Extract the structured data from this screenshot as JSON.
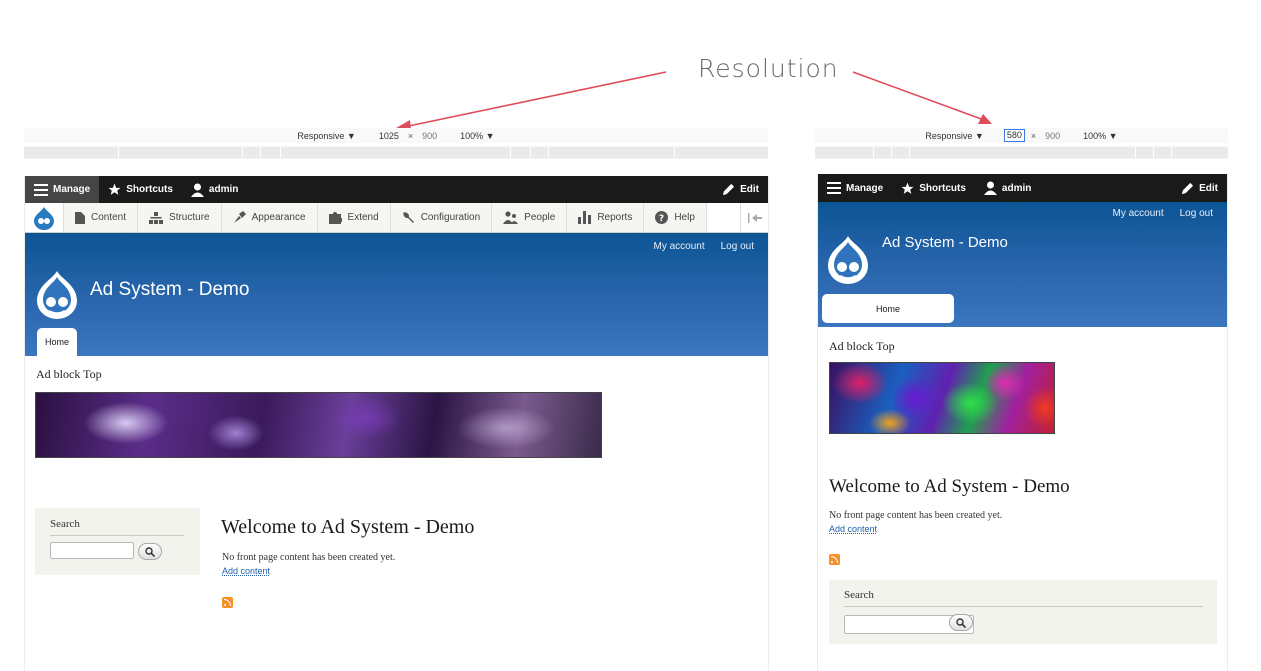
{
  "annotation": {
    "label": "Resolution"
  },
  "left_view": {
    "device": {
      "mode": "Responsive ▼",
      "width": "1025",
      "times": "×",
      "height": "900",
      "zoom": "100% ▼"
    },
    "toolbar": {
      "manage": "Manage",
      "shortcuts": "Shortcuts",
      "user": "admin",
      "edit": "Edit"
    },
    "tray": [
      "Content",
      "Structure",
      "Appearance",
      "Extend",
      "Configuration",
      "People",
      "Reports",
      "Help"
    ],
    "header": {
      "my_account": "My account",
      "logout": "Log out",
      "site_name": "Ad System - Demo",
      "home_tab": "Home"
    },
    "content": {
      "ad_title": "Ad block Top",
      "search_title": "Search",
      "welcome": "Welcome to Ad System - Demo",
      "no_content": "No front page content has been created yet.",
      "add_content": "Add content"
    }
  },
  "right_view": {
    "device": {
      "mode": "Responsive ▼",
      "width": "580",
      "times": "×",
      "height": "900",
      "zoom": "100% ▼"
    },
    "toolbar": {
      "manage": "Manage",
      "shortcuts": "Shortcuts",
      "user": "admin",
      "edit": "Edit"
    },
    "header": {
      "my_account": "My account",
      "logout": "Log out",
      "site_name": "Ad System - Demo",
      "home_tab": "Home"
    },
    "content": {
      "ad_title": "Ad block Top",
      "welcome": "Welcome to Ad System - Demo",
      "no_content": "No front page content has been created yet.",
      "add_content": "Add content",
      "search_title": "Search"
    }
  },
  "colors": {
    "toolbar_bg": "#1a1a1a",
    "header_blue": "#2a66ad",
    "annotation_red": "#e04b5a",
    "rss_orange": "#f78f2a"
  }
}
